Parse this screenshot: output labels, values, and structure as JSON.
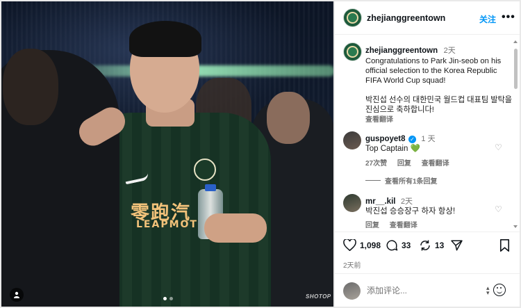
{
  "photo": {
    "jersey_sponsor_cn": "零跑汽",
    "jersey_sponsor_en": "LEAPMOT",
    "credit": "SHOTOP",
    "carousel_total": 2,
    "carousel_active": 1
  },
  "header": {
    "username": "zhejianggreentown",
    "follow_label": "关注",
    "more_icon": "more-horizontal-icon"
  },
  "caption": {
    "username": "zhejianggreentown",
    "time": "2天",
    "text_en": "Congratulations to Park Jin-seob on his official selection to the Korea Republic FIFA World Cup squad!",
    "text_ko": "박진섭 선수의 대한민국 월드컵 대표팀 발탁을 진심으로 축하합니다!",
    "see_translation": "查看翻译"
  },
  "comments": [
    {
      "username": "guspoyet8",
      "verified": true,
      "time": "1 天",
      "text": "Top Captain 💚",
      "likes": "27次赞",
      "reply": "回复",
      "see_translation": "查看翻译",
      "view_replies": "查看所有1条回复"
    },
    {
      "username": "mr__.kil",
      "verified": false,
      "time": "2天",
      "text": "박진섭 승승장구 하자 항상!",
      "reply": "回复",
      "see_translation": "查看翻译"
    }
  ],
  "actions": {
    "like_count": "1,098",
    "comment_count": "33",
    "share_count": "13",
    "posted_ago": "2天前"
  },
  "add_comment": {
    "placeholder": "添加评论..."
  },
  "colors": {
    "accent": "#0095f6",
    "muted": "#737373",
    "brand_green": "#1d5a3b"
  }
}
